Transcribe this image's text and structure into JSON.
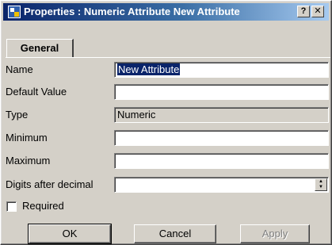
{
  "window": {
    "title": "Properties : Numeric Attribute New Attribute",
    "help_label": "?",
    "close_label": "✕",
    "app_icon": "properties-icon"
  },
  "tabs": [
    {
      "label": "General",
      "active": true
    }
  ],
  "fields": {
    "name": {
      "label": "Name",
      "value": "New Attribute"
    },
    "default_value": {
      "label": "Default Value",
      "value": ""
    },
    "type": {
      "label": "Type",
      "value": "Numeric"
    },
    "minimum": {
      "label": "Minimum",
      "value": ""
    },
    "maximum": {
      "label": "Maximum",
      "value": ""
    },
    "digits_after_decimal": {
      "label": "Digits after decimal",
      "value": ""
    }
  },
  "required": {
    "label": "Required",
    "checked": false
  },
  "buttons": {
    "ok": "OK",
    "cancel": "Cancel",
    "apply": "Apply"
  },
  "colors": {
    "face": "#d4d0c8",
    "title_start": "#0a246a",
    "title_end": "#a6caf0",
    "selection": "#0a246a"
  }
}
